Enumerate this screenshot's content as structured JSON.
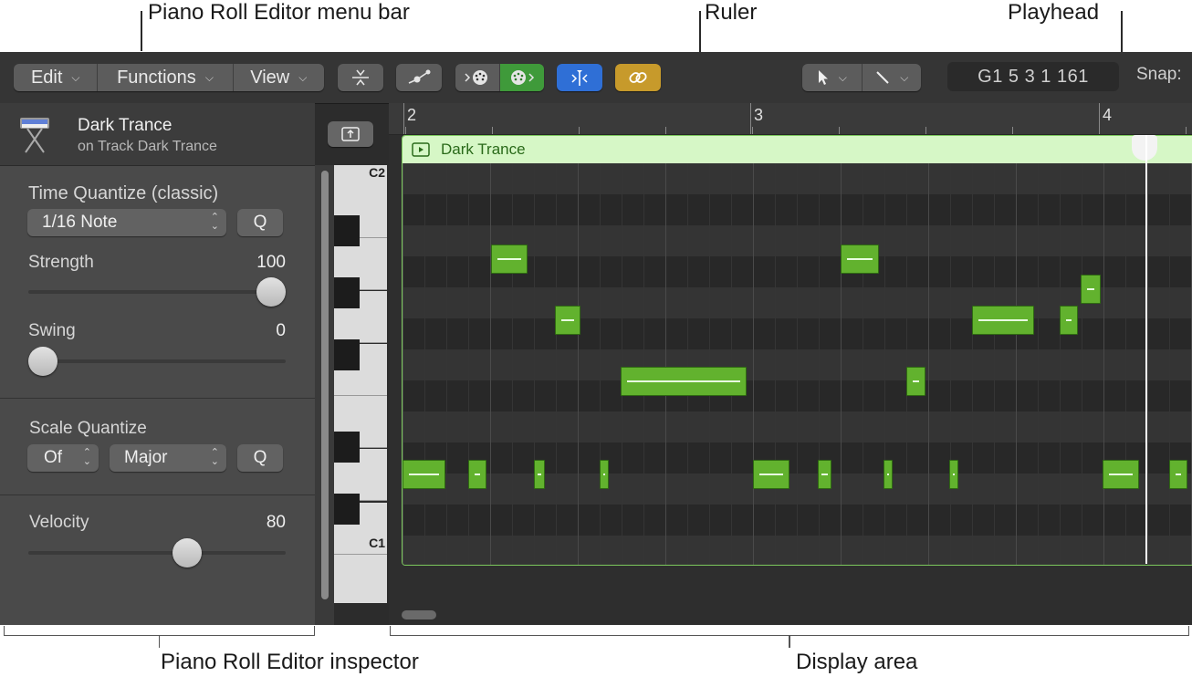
{
  "callouts": {
    "menu_bar": "Piano Roll Editor menu bar",
    "ruler": "Ruler",
    "playhead": "Playhead",
    "inspector": "Piano Roll Editor inspector",
    "display_area": "Display area"
  },
  "toolbar": {
    "menus": [
      "Edit",
      "Functions",
      "View"
    ],
    "lcd": "G1   5 3 1 161",
    "snap_label": "Snap:"
  },
  "track": {
    "name": "Dark Trance",
    "subtitle": "on Track Dark Trance"
  },
  "inspector": {
    "time_quantize": {
      "title": "Time Quantize (classic)",
      "value": "1/16 Note",
      "q_label": "Q",
      "strength_label": "Strength",
      "strength_value": "100",
      "strength_fraction": 1.0,
      "swing_label": "Swing",
      "swing_value": "0",
      "swing_fraction": 0.0
    },
    "scale_quantize": {
      "title": "Scale Quantize",
      "root": "Of",
      "scale": "Major",
      "q_label": "Q"
    },
    "velocity": {
      "label": "Velocity",
      "value": "80",
      "fraction": 0.63
    }
  },
  "keyboard": {
    "labels": [
      "C2",
      "C1"
    ]
  },
  "ruler": {
    "bars": [
      "2",
      "3",
      "4"
    ]
  },
  "region": {
    "name": "Dark Trance",
    "color": "#62b22e",
    "header_color": "#d6f7c6"
  }
}
